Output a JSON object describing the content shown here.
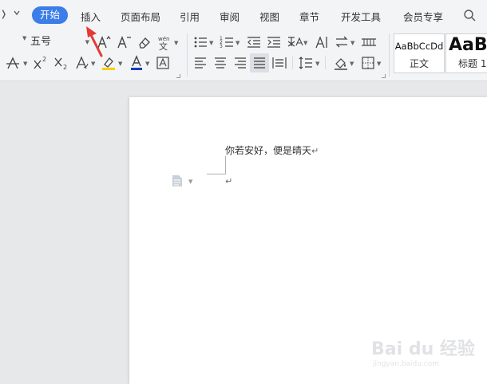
{
  "menubar": {
    "tabs": [
      {
        "label": "开始",
        "active": true
      },
      {
        "label": "插入"
      },
      {
        "label": "页面布局"
      },
      {
        "label": "引用"
      },
      {
        "label": "审阅"
      },
      {
        "label": "视图"
      },
      {
        "label": "章节"
      },
      {
        "label": "开发工具"
      },
      {
        "label": "会员专享"
      }
    ]
  },
  "ribbon": {
    "font_size": "五号",
    "styles": [
      {
        "sample": "AaBbCcDd",
        "name": "正文"
      },
      {
        "sample": "AaB",
        "name": "标题 1"
      }
    ]
  },
  "document": {
    "line1": "你若安好，便是晴天",
    "paragraph_mark": "↵"
  },
  "watermark": {
    "brand": "Bai du 经验",
    "url": "jingyan.baidu.com"
  },
  "colors": {
    "accent": "#3b7de9",
    "highlight": "#f5d000",
    "font_color": "#c0392b",
    "arrow": "#e53935"
  }
}
